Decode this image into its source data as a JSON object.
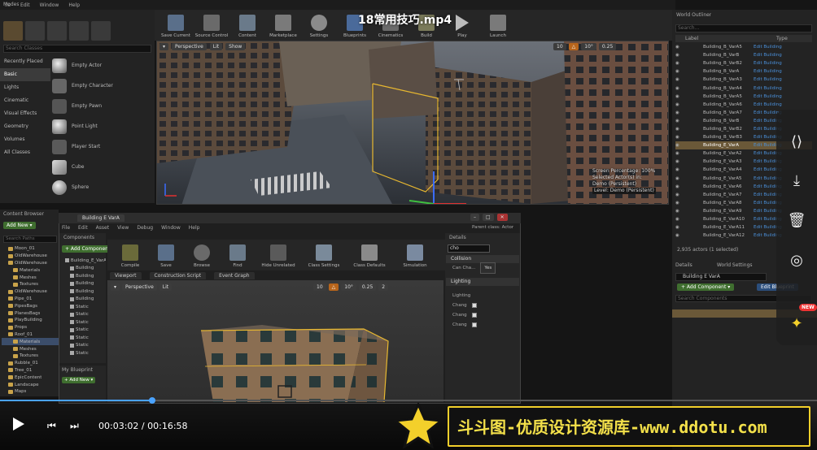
{
  "video": {
    "title": "18常用技巧.mp4",
    "current_time": "00:03:02",
    "duration": "00:16:58",
    "separator": "/",
    "progress": 0.186
  },
  "menubar": [
    "ile",
    "Edit",
    "Window",
    "Help"
  ],
  "modes": {
    "tab": "Modes",
    "search_placeholder": "Search Classes",
    "categories": [
      "Recently Placed",
      "Basic",
      "Lights",
      "Cinematic",
      "Visual Effects",
      "Geometry",
      "Volumes",
      "All Classes"
    ],
    "selected_category": "Basic",
    "items": [
      "Empty Actor",
      "Empty Character",
      "Empty Pawn",
      "Point Light",
      "Player Start",
      "Cube",
      "Sphere"
    ]
  },
  "toolbar": {
    "buttons": [
      "Save Current",
      "Source Control",
      "Content",
      "Marketplace",
      "Settings",
      "Blueprints",
      "Cinematics",
      "Build",
      "Play",
      "Launch"
    ]
  },
  "viewport_top": {
    "perspective": "Perspective",
    "lit": "Lit",
    "show": "Show",
    "snap_value": "10",
    "angle_value": "10°",
    "scale_value": "0.25",
    "info_line1": "Screen Percentage: 100%",
    "info_line2": "Selected Actor(s) in:",
    "info_line3": "Demo (Persistent)",
    "level": "Level: Demo (Persistent)"
  },
  "outliner": {
    "title": "World Outliner",
    "search_placeholder": "Search...",
    "col_label": "Label",
    "col_type": "Type",
    "rows": [
      "Building_B_VarA5",
      "Building_B_VarB",
      "Building_B_VarB2",
      "Building_B_VarA",
      "Building_B_VarA3",
      "Building_B_VarA4",
      "Building_B_VarA5",
      "Building_B_VarA6",
      "Building_B_VarA7",
      "Building_B_VarB",
      "Building_B_VarB2",
      "Building_B_VarB3",
      "Building_E_VarA",
      "Building_E_VarA2",
      "Building_E_VarA3",
      "Building_E_VarA4",
      "Building_E_VarA5",
      "Building_E_VarA6",
      "Building_E_VarA7",
      "Building_E_VarA8",
      "Building_E_VarA9",
      "Building_E_VarA10",
      "Building_E_VarA11",
      "Building_E_VarA12"
    ],
    "selected_index": 12,
    "type_label": "Edit Building",
    "count": "2,935 actors (1 selected)"
  },
  "details_right": {
    "tab_details": "Details",
    "tab_world": "World Settings",
    "name": "Building E VarA",
    "add_component": "+ Add Component ▾",
    "edit_blueprint": "Edit Blueprint",
    "search_placeholder": "Search Components"
  },
  "content_browser": {
    "tab": "Content Browser",
    "add_new": "Add New ▾",
    "search_placeholder": "Search Paths",
    "tree": [
      "Moon_01",
      "OldWarehouse",
      "OldWarehouse",
      "Materials",
      "Meshes",
      "Textures",
      "OldWarehouse",
      "Pipe_01",
      "PipesBags",
      "PlanesBags",
      "PlayBuilding",
      "Props",
      "Roof_01",
      "Materials",
      "Meshes",
      "Textures",
      "Rubble_01",
      "Tree_01",
      "EpicContent",
      "Landscape",
      "Maps"
    ],
    "selected_index": 13
  },
  "blueprint": {
    "tab": "Building E VarA",
    "parent": "Parent class: Actor",
    "menu": [
      "File",
      "Edit",
      "Asset",
      "View",
      "Debug",
      "Window",
      "Help"
    ],
    "components_title": "Components",
    "add_component": "+ Add Component ▾",
    "components": [
      "Building_E_VarA",
      "Building",
      "Building",
      "Building",
      "Building",
      "Building",
      "Static",
      "Static",
      "Static",
      "Static",
      "Static",
      "Static",
      "Static"
    ],
    "my_blueprint": "My Blueprint",
    "add_new": "+ Add New ▾",
    "toolbar": [
      "Compile",
      "Save",
      "Browse",
      "Find",
      "Hide Unrelated",
      "Class Settings",
      "Class Defaults",
      "Simulation"
    ],
    "tabs": [
      "Viewport",
      "Construction Script",
      "Event Graph"
    ],
    "vp_perspective": "Perspective",
    "vp_lit": "Lit",
    "snap_value": "10",
    "angle_value": "10°",
    "scale_value": "0.25",
    "cam_value": "2",
    "details_title": "Details",
    "search_value": "cho",
    "collision": "Collision",
    "can_label": "Can Cha...",
    "can_value": "Yes",
    "lighting": "Lighting",
    "lighting_sub": "Lighting",
    "check_labels": [
      "Chang",
      "Chang",
      "Chang"
    ]
  },
  "side_overlay": {
    "new_badge": "NEW"
  },
  "watermark": {
    "text": "斗斗图-优质设计资源库-www.ddotu.com"
  },
  "colors": {
    "accent_blue": "#4aa3ff",
    "watermark_yellow": "#f3d02b",
    "green_button": "#3f6e2f",
    "selection": "#6a5838"
  }
}
